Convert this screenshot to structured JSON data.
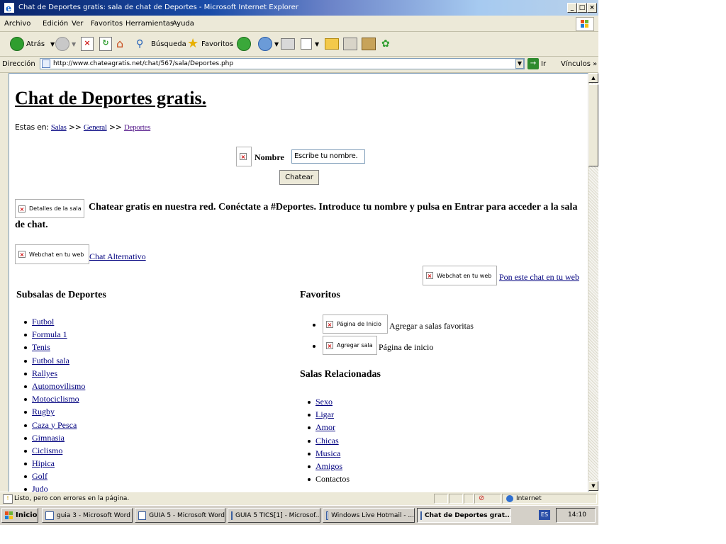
{
  "window": {
    "title": "Chat de Deportes gratis: sala de chat de Deportes - Microsoft Internet Explorer",
    "controls": {
      "minimize": "_",
      "maximize": "□",
      "close": "×"
    }
  },
  "menu": [
    "Archivo",
    "Edición",
    "Ver",
    "Favoritos",
    "Herramientas",
    "Ayuda"
  ],
  "toolbar": {
    "back_label": "Atrás",
    "search_label": "Búsqueda",
    "favorites_label": "Favoritos"
  },
  "address": {
    "label": "Dirección",
    "url": "http://www.chateagratis.net/chat/567/sala/Deportes.php",
    "go_label": "Ir",
    "links_label": "Vínculos",
    "links_more": "»"
  },
  "page": {
    "title": "Chat de Deportes gratis.",
    "breadcrumb": {
      "prefix": "Estas en:",
      "sep": ">>",
      "items": [
        "Salas",
        "General",
        "Deportes"
      ]
    },
    "form": {
      "name_label": "Nombre",
      "name_value": "Escribe tu nombre.",
      "submit_label": "Chatear"
    },
    "intro": {
      "image_alt": "Detalles de la sala",
      "text": "Chatear gratis en nuestra red. Conéctate a #Deportes. Introduce tu nombre y pulsa en Entrar para acceder a la sala de chat."
    },
    "alt_chat": {
      "image_alt": "Webchat en tu web",
      "link": "Chat Alternativo"
    },
    "put_chat": {
      "image_alt": "Webchat en tu web",
      "link": "Pon este chat en tu web"
    },
    "subsalas": {
      "heading": "Subsalas de Deportes",
      "items": [
        "Futbol",
        "Formula 1",
        "Tenis",
        "Futbol sala",
        "Rallyes",
        "Automovilismo",
        "Motociclismo",
        "Rugby",
        "Caza y Pesca",
        "Gimnasia",
        "Ciclismo",
        "Hipica",
        "Golf",
        "Judo"
      ]
    },
    "favoritos": {
      "heading": "Favoritos",
      "items": [
        {
          "image_alt": "Página de Inicio",
          "text": "Agregar a salas favoritas"
        },
        {
          "image_alt": "Agregar sala",
          "text": "Página de inicio"
        }
      ]
    },
    "relacionadas": {
      "heading": "Salas Relacionadas",
      "items": [
        "Sexo",
        "Ligar",
        "Amor",
        "Chicas",
        "Musica",
        "Amigos",
        "Contactos"
      ]
    }
  },
  "status": {
    "text": "Listo, pero con errores en la página.",
    "zone": "Internet"
  },
  "taskbar": {
    "start_label": "Inicio",
    "tasks": [
      "guia 3 - Microsoft Word",
      "GUIA 5 - Microsoft Word",
      "GUIA 5 TICS[1] - Microsof...",
      "Windows Live Hotmail - ...",
      "Chat de Deportes grat..."
    ],
    "lang": "ES",
    "clock": "14:10"
  }
}
